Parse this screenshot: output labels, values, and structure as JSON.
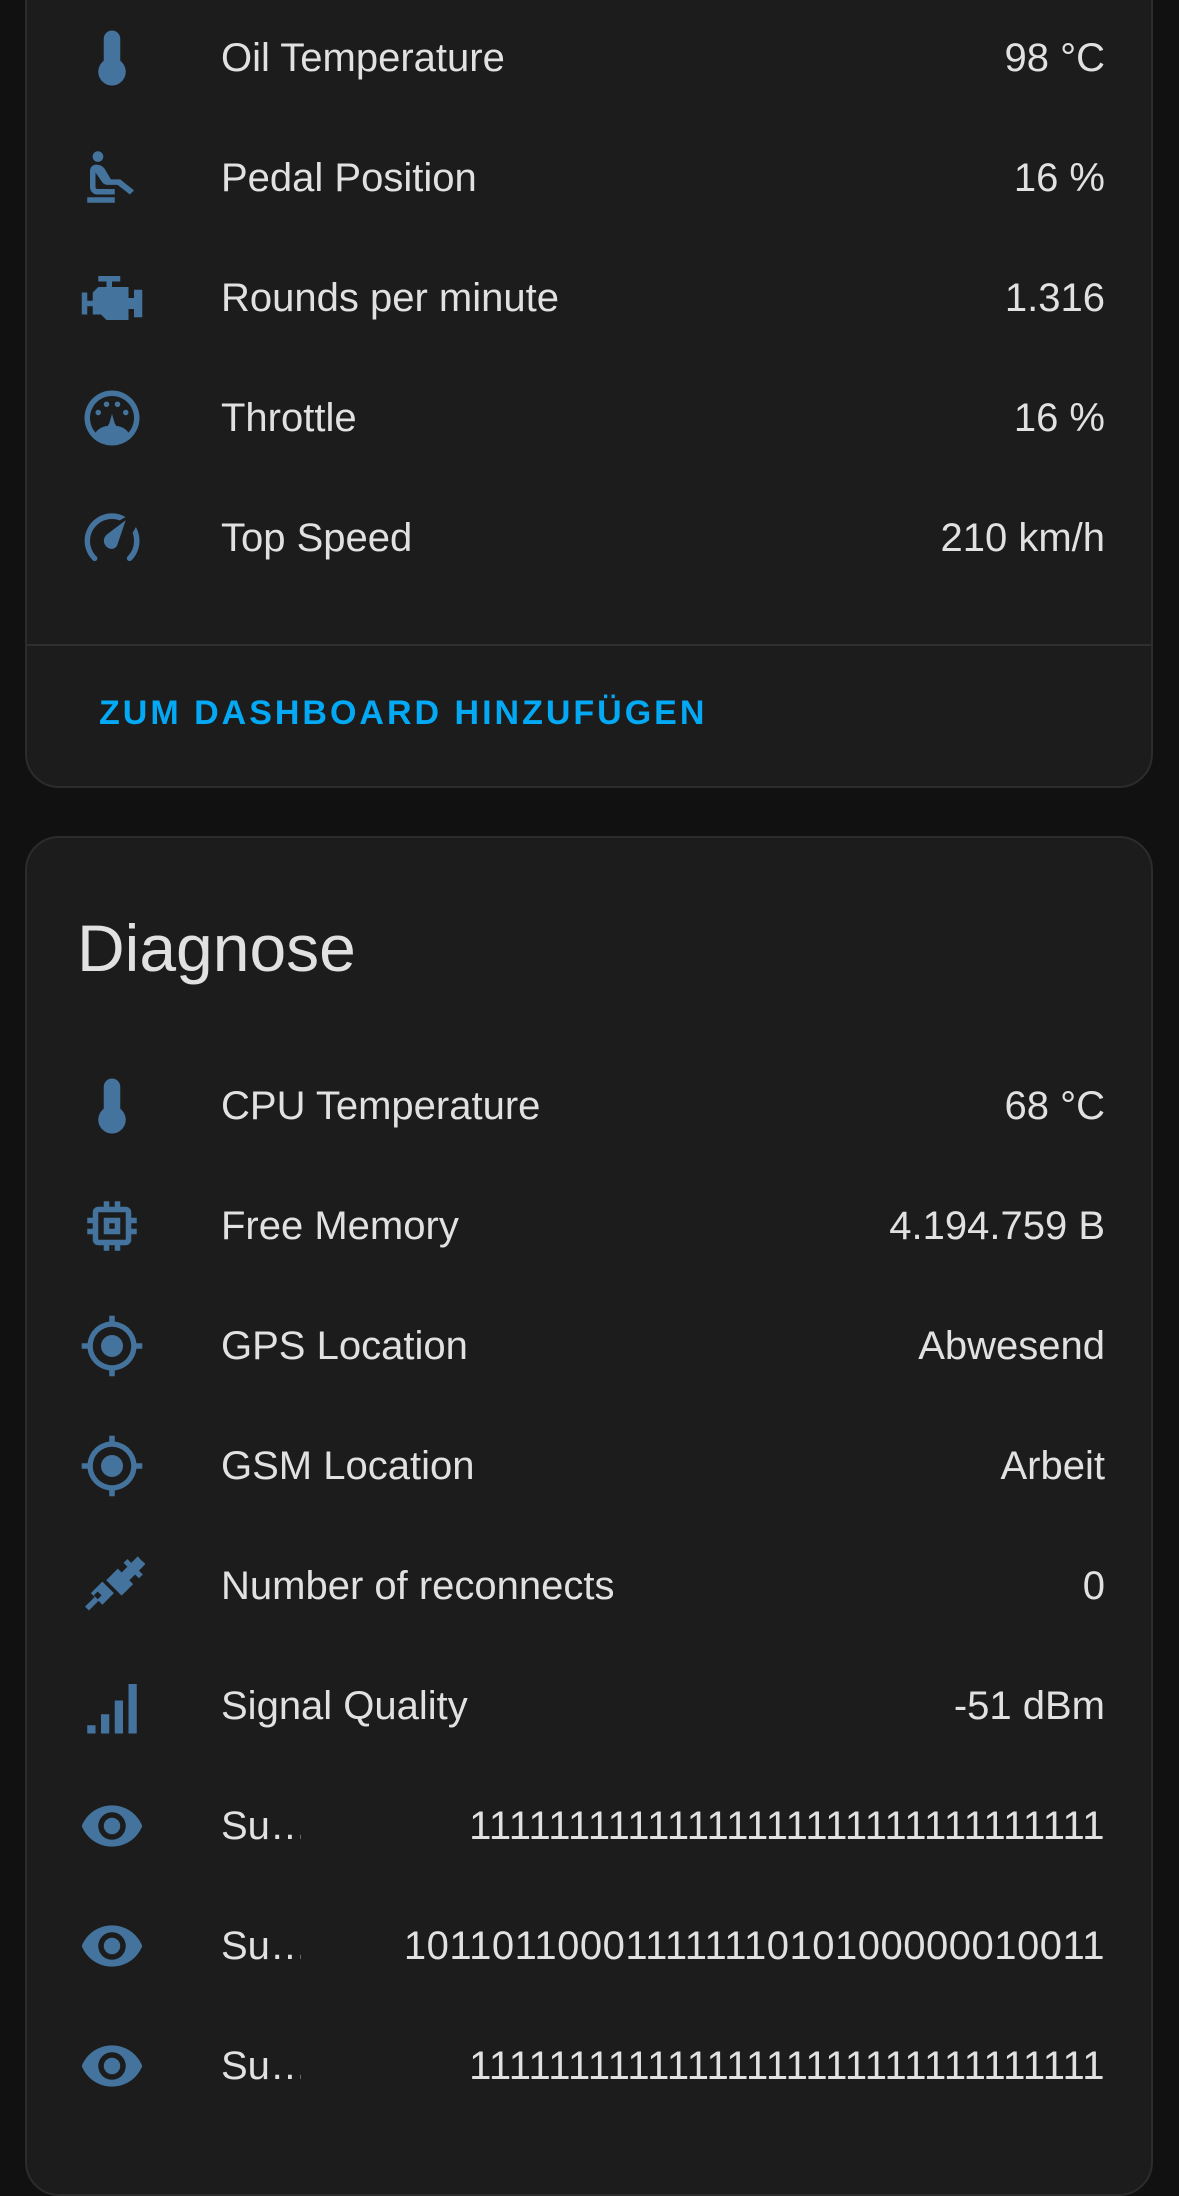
{
  "top_card": {
    "rows": [
      {
        "label": "Oil Temperature",
        "value": "98 °C",
        "icon": "thermometer-icon"
      },
      {
        "label": "Pedal Position",
        "value": "16 %",
        "icon": "car-seat-driver-icon"
      },
      {
        "label": "Rounds per minute",
        "value": "1.316",
        "icon": "engine-icon"
      },
      {
        "label": "Throttle",
        "value": "16 %",
        "icon": "gauge-icon"
      },
      {
        "label": "Top Speed",
        "value": "210 km/h",
        "icon": "speedometer-icon"
      }
    ],
    "action_label": "ZUM DASHBOARD HINZUFÜGEN"
  },
  "diag_card": {
    "title": "Diagnose",
    "rows": [
      {
        "label": "CPU Temperature",
        "value": "68 °C",
        "icon": "thermometer-icon"
      },
      {
        "label": "Free Memory",
        "value": "4.194.759 B",
        "icon": "chip-icon"
      },
      {
        "label": "GPS Location",
        "value": "Abwesend",
        "icon": "crosshairs-gps-icon"
      },
      {
        "label": "GSM Location",
        "value": "Arbeit",
        "icon": "crosshairs-gps-icon"
      },
      {
        "label": "Number of reconnects",
        "value": "0",
        "icon": "connection-icon"
      },
      {
        "label": "Signal Quality",
        "value": "-51 dBm",
        "icon": "signal-bars-icon"
      },
      {
        "label": "Su…",
        "value": "11111111111111111111111111111111",
        "icon": "eye-icon"
      },
      {
        "label": "Su…",
        "value": "10110110001111111010100000010011",
        "icon": "eye-icon"
      },
      {
        "label": "Su…",
        "value": "11111111111111111111111111111111",
        "icon": "eye-icon"
      }
    ]
  },
  "colors": {
    "background": "#111111",
    "card": "#1c1c1c",
    "icon": "#44739e",
    "text": "#e1e1e1",
    "accent": "#03a9f4"
  }
}
